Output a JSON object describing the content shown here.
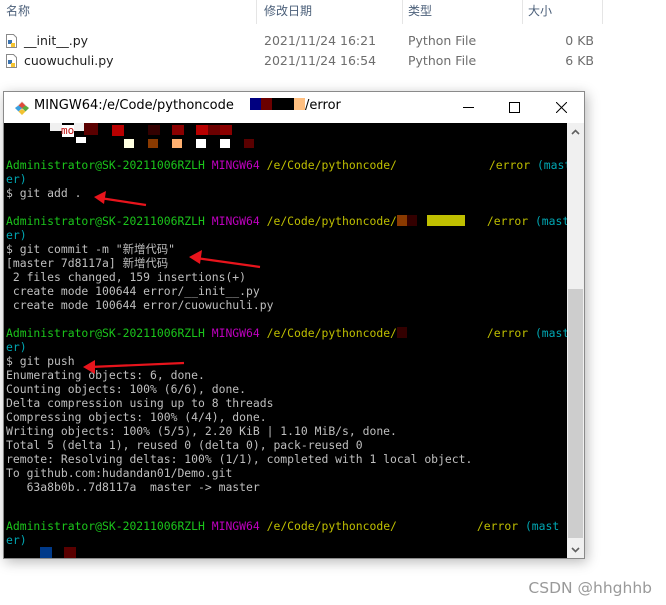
{
  "explorer": {
    "columns": [
      {
        "label": "名称"
      },
      {
        "label": "修改日期"
      },
      {
        "label": "类型"
      },
      {
        "label": "大小"
      }
    ],
    "files": [
      {
        "name": "__init__.py",
        "modified": "2021/11/24 16:21",
        "type": "Python File",
        "size": "0 KB",
        "icon": "python-file-icon"
      },
      {
        "name": "cuowuchuli.py",
        "modified": "2021/11/24 16:54",
        "type": "Python File",
        "size": "6 KB",
        "icon": "python-file-icon"
      }
    ]
  },
  "window": {
    "title_prefix": "MINGW64:/e/Code/pythoncode",
    "title_suffix": "/error",
    "app_icon": "git-bash-diamond-icon",
    "controls": {
      "minimize": "minimize-icon",
      "maximize": "maximize-icon",
      "close": "close-icon"
    }
  },
  "terminal": {
    "prompt": {
      "user_host": "Administrator@SK-20211006RZLH",
      "system": "MINGW64",
      "path_prefix": "/e/Code/pythoncode/",
      "path_suffix": "/error",
      "branch_open": "(mast",
      "branch_close": "er)",
      "dollar": "$"
    },
    "blocks": [
      {
        "command": "git add .",
        "output": []
      },
      {
        "command": "git commit -m \"新增代码\"",
        "output": [
          "[master 7d8117a] 新增代码",
          " 2 files changed, 159 insertions(+)",
          " create mode 100644 error/__init__.py",
          " create mode 100644 error/cuowuchuli.py"
        ]
      },
      {
        "command": "git push",
        "output": [
          "Enumerating objects: 6, done.",
          "Counting objects: 100% (6/6), done.",
          "Delta compression using up to 8 threads",
          "Compressing objects: 100% (4/4), done.",
          "Writing objects: 100% (5/5), 2.20 KiB | 1.10 MiB/s, done.",
          "Total 5 (delta 1), reused 0 (delta 0), pack-reused 0",
          "remote: Resolving deltas: 100% (1/1), completed with 1 local object.",
          "To github.com:hudandan01/Demo.git",
          "   63a8b0b..7d8117a  master -> master"
        ]
      }
    ],
    "partial_top_text": "mo"
  },
  "scrollbar": {
    "position_fraction": 0.58,
    "visible_fraction": 0.62
  },
  "colors": {
    "terminal_bg": "#000000",
    "prompt_user": "#1bc51b",
    "prompt_system": "#bf00bf",
    "prompt_path": "#bfbf00",
    "prompt_branch": "#00a6b2",
    "annotation_arrow": "#e8141c"
  },
  "watermark": "CSDN @hhghhb"
}
